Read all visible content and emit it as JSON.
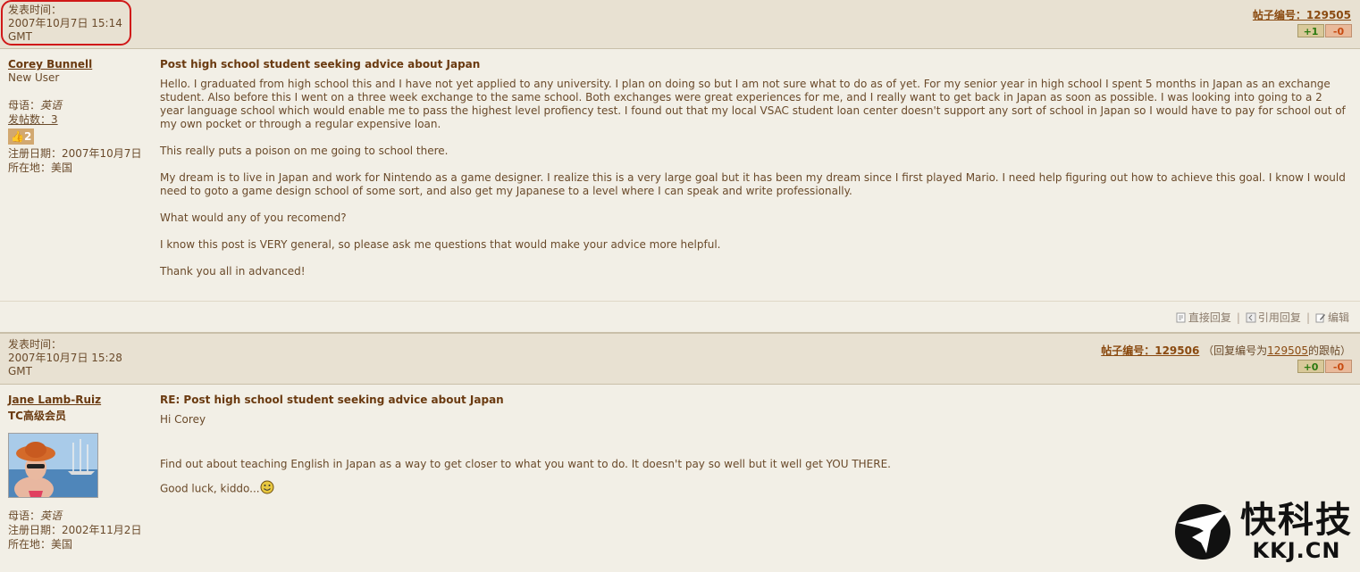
{
  "post1": {
    "time_label": "发表时间：",
    "time_value": "2007年10月7日 15:14",
    "time_tz": "GMT",
    "post_num_text": "帖子编号：129505",
    "vote_up": "+1",
    "vote_down": "-0",
    "user_name": "Corey Bunnell",
    "user_rank": "New User",
    "native_label": "母语：",
    "native_value": "英语",
    "posts_label": "发帖数：3",
    "thumbs_count": "2",
    "reg_label": "注册日期：2007年10月7日",
    "location_label": "所在地：美国",
    "title": "Post high school student seeking advice about Japan",
    "paragraphs": [
      "Hello. I graduated from high school this and I have not yet applied to any university. I plan on doing so but I am not sure what to do as of yet. For my senior year in high school I spent 5 months in Japan as an exchange student. Also before this I went on a three week exchange to the same school. Both exchanges were great experiences for me, and I really want to get back in Japan as soon as possible. I was looking into going to a 2 year language school which would enable me to pass the highest level profiency test. I found out that my local VSAC student loan center doesn't support any sort of school in Japan so I would have to pay for school out of my own pocket or through a regular expensive loan.",
      "This really puts a poison on me going to school there.",
      "My dream is to live in Japan and work for Nintendo as a game designer. I realize this is a very large goal but it has been my dream since I first played Mario. I need help figuring out how to achieve this goal. I know I would need to goto a game design school of some sort, and also get my Japanese to a level where I can speak and write professionally.",
      "What would any of you recomend?",
      "I know this post is VERY general, so please ask me questions that would make your advice more helpful.",
      "Thank you all in advanced!"
    ],
    "actions": {
      "direct_reply": "直接回复",
      "quote_reply": "引用回复",
      "edit": "编辑"
    }
  },
  "post2": {
    "time_label": "发表时间：",
    "time_value": "2007年10月7日 15:28",
    "time_tz": "GMT",
    "post_num_text": "帖子编号：129506",
    "reply_prefix": "（回复编号为",
    "reply_num": "129505",
    "reply_suffix": "的跟帖）",
    "vote_up": "+0",
    "vote_down": "-0",
    "user_name": "Jane Lamb-Ruiz",
    "user_rank": "TC高级会员",
    "native_label": "母语：",
    "native_value": "英语",
    "reg_label": "注册日期：2002年11月2日",
    "location_label": "所在地：美国",
    "title": "RE: Post high school student seeking advice about Japan",
    "greeting": "Hi Corey",
    "body": "Find out about teaching English in Japan as a way to get closer to what you want to do. It doesn't pay so well but it well get YOU THERE.",
    "closing": "Good luck, kiddo..."
  },
  "watermark": {
    "cn": "快科技",
    "en": "KKJ.CN"
  }
}
